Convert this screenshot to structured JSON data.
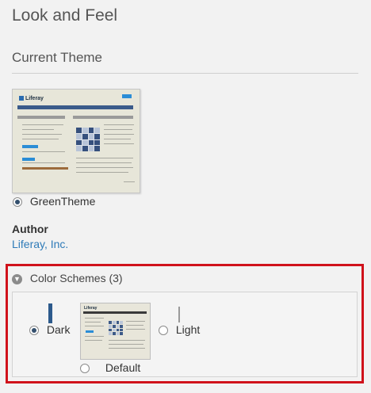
{
  "page": {
    "title": "Look and Feel"
  },
  "current_theme": {
    "section_title": "Current Theme",
    "thumbnail_logo": "Liferay",
    "theme_name": "GreenTheme",
    "selected": true
  },
  "author": {
    "label": "Author",
    "name": "Liferay, Inc."
  },
  "color_schemes": {
    "header": "Color Schemes (3)",
    "options": [
      {
        "label": "Dark",
        "selected": true,
        "swatch_color": "#2c5a8c"
      },
      {
        "label": "Default",
        "selected": false
      },
      {
        "label": "Light",
        "selected": false,
        "swatch_color": "#9a9a9a"
      }
    ]
  },
  "colors": {
    "link": "#2f7bb8",
    "highlight": "#d0121b",
    "accent": "#2b8dd6"
  }
}
